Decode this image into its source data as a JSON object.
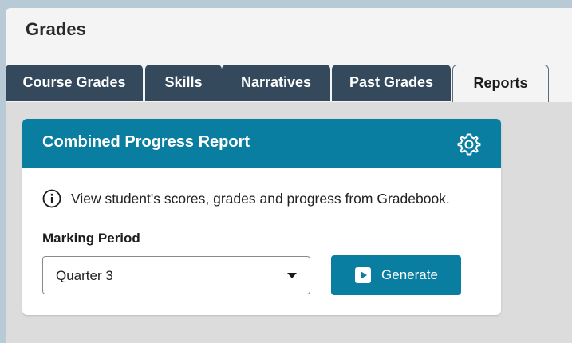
{
  "page": {
    "title": "Grades"
  },
  "tabs": [
    {
      "label": "Course Grades",
      "active": false
    },
    {
      "label": "Skills",
      "active": false
    },
    {
      "label": "Narratives",
      "active": false
    },
    {
      "label": "Past Grades",
      "active": false
    },
    {
      "label": "Reports",
      "active": true
    }
  ],
  "card": {
    "title": "Combined Progress Report",
    "settings_icon": "gear-icon",
    "info_icon": "info-circle-icon",
    "info_text": "View student's scores, grades and progress from Gradebook.",
    "marking_period_label": "Marking Period",
    "marking_period_value": "Quarter 3",
    "generate_label": "Generate",
    "generate_icon": "play-icon"
  },
  "colors": {
    "accent": "#0a7ea1",
    "tab_bg": "#34495c",
    "panel_bg": "#f4f4f4",
    "content_bg": "#dcdcdc",
    "outer_bg": "#b7cad6"
  }
}
